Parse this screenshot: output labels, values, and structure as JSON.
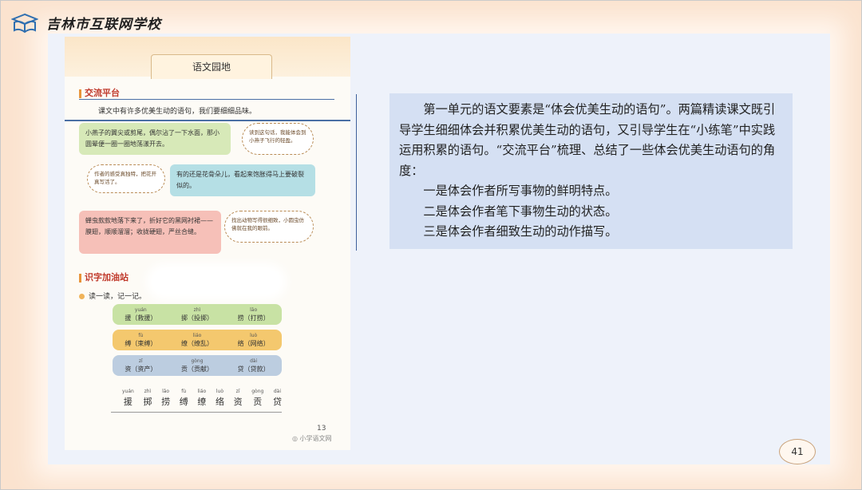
{
  "header": {
    "school_name": "吉林市互联网学校"
  },
  "textbook": {
    "page_title": "语文园地",
    "section1_title": "交流平台",
    "intro": "课文中有许多优美生动的语句，我们要细细品味。",
    "bubbles": [
      "小燕子的翼尖或剪尾，偶尔沾了一下水面，那小圆晕便一圈一圈地荡漾开去。",
      "读到这句话，我能体会到小燕子飞行的轻盈。",
      "作者的感受真独特，把花开真写活了。",
      "有的还是花骨朵儿，看起来饱胀得马上要破裂似的。",
      "蝉虫款款地落下来了，折好它的黑网衬裙——膜翅，顺顺溜溜；收拢硬翅，严丝合缝。",
      "找出动物写得很细致，小圆虫仿佛就在我的眼前。"
    ],
    "section2_title": "识字加油站",
    "read_instruction": "读一读，记一记。",
    "word_rows": [
      [
        {
          "py": "yuán",
          "text": "援（救援）"
        },
        {
          "py": "zhì",
          "text": "掷（投掷）"
        },
        {
          "py": "lāo",
          "text": "捞（打捞）"
        }
      ],
      [
        {
          "py": "fù",
          "text": "缚（束缚）"
        },
        {
          "py": "liáo",
          "text": "缭（缭乱）"
        },
        {
          "py": "luò",
          "text": "络（网络）"
        }
      ],
      [
        {
          "py": "zī",
          "text": "资（资产）"
        },
        {
          "py": "gòng",
          "text": "贡（贡献）"
        },
        {
          "py": "dài",
          "text": "贷（贷款）"
        }
      ]
    ],
    "char_row": [
      {
        "py": "yuán",
        "ch": "援"
      },
      {
        "py": "zhì",
        "ch": "掷"
      },
      {
        "py": "lāo",
        "ch": "捞"
      },
      {
        "py": "fù",
        "ch": "缚"
      },
      {
        "py": "liáo",
        "ch": "缭"
      },
      {
        "py": "luò",
        "ch": "络"
      },
      {
        "py": "zī",
        "ch": "资"
      },
      {
        "py": "gòng",
        "ch": "贡"
      },
      {
        "py": "dài",
        "ch": "贷"
      }
    ],
    "page_number": "13",
    "watermark": "小学语文网"
  },
  "explanation": {
    "lines": [
      "第一单元的语文要素是“体会优美生动的语句”。两篇精读课文既引导学生细细体会并积累优美生动的语句，又引导学生在“小练笔”中实践运用积累的语句。“交流平台”梳理、总结了一些体会优美生动语句的角度：",
      "一是体会作者所写事物的鲜明特点。",
      "二是体会作者笔下事物生动的状态。",
      "三是体会作者细致生动的动作描写。"
    ]
  },
  "slide_number": "41"
}
